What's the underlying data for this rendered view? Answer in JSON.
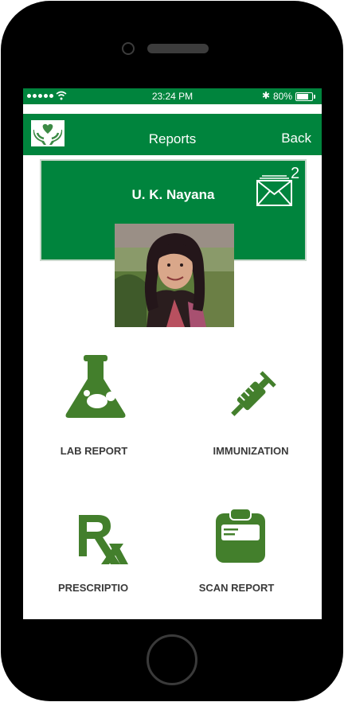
{
  "status_bar": {
    "time": "23:24 PM",
    "battery": "80%",
    "battery_level": 0.8
  },
  "nav": {
    "title": "Reports",
    "back_label": "Back"
  },
  "profile": {
    "name": "U. K. Nayana",
    "unread_count": "2"
  },
  "menu": [
    {
      "label": "LAB REPORT",
      "icon": "flask-icon"
    },
    {
      "label": "IMMUNIZATION",
      "icon": "syringe-icon"
    },
    {
      "label": "PRESCRIPTIO",
      "icon": "rx-icon"
    },
    {
      "label": "SCAN REPORT",
      "icon": "clipboard-icon"
    }
  ],
  "colors": {
    "primary": "#00843d",
    "icon": "#437f2c",
    "label": "#3a3a3a"
  }
}
